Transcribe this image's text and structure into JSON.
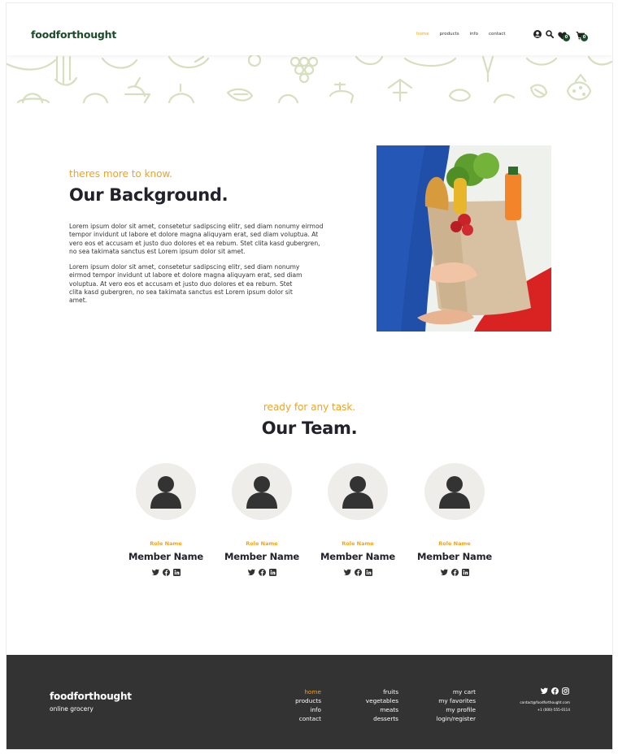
{
  "header": {
    "logo": "foodforthought",
    "nav": [
      "home",
      "products",
      "info",
      "contact"
    ],
    "favorites_count": "0",
    "cart_count": "0"
  },
  "background": {
    "subtitle": "theres more to know.",
    "title": "Our Background.",
    "paragraph1": "Lorem ipsum dolor sit amet, consetetur sadipscing elitr, sed diam nonumy eirmod tempor invidunt ut labore et dolore magna aliquyam erat, sed diam voluptua. At vero eos et accusam et justo duo dolores et ea rebum. Stet clita kasd gubergren, no sea takimata sanctus est Lorem ipsum dolor sit amet.",
    "paragraph2": "Lorem ipsum dolor sit amet, consetetur sadipscing elitr, sed diam nonumy eirmod tempor invidunt ut labore et dolore magna aliquyam erat, sed diam voluptua. At vero eos et accusam et justo duo dolores et ea rebum. Stet clita kasd gubergren, no sea takimata sanctus est Lorem ipsum dolor sit amet."
  },
  "team": {
    "subtitle": "ready for any task.",
    "title": "Our Team.",
    "members": [
      {
        "role": "Role Name",
        "name": "Member Name"
      },
      {
        "role": "Role Name",
        "name": "Member Name"
      },
      {
        "role": "Role Name",
        "name": "Member Name"
      },
      {
        "role": "Role Name",
        "name": "Member Name"
      }
    ]
  },
  "footer": {
    "logo": "foodforthought",
    "tagline": "online grocery",
    "nav_links": [
      "home",
      "products",
      "info",
      "contact"
    ],
    "category_links": [
      "fruits",
      "vegetables",
      "meats",
      "desserts"
    ],
    "account_links": [
      "my cart",
      "my favorites",
      "my profile",
      "login/register"
    ],
    "email": "contact@foodforthought.com",
    "phone": "+1 (000)-555-0114"
  },
  "colors": {
    "accent": "#f2a31b",
    "brand_green": "#1d4a2a",
    "footer_bg": "#333333",
    "pattern": "#dbe3c2"
  },
  "icons": [
    "user-icon",
    "search-icon",
    "heart-icon",
    "cart-icon",
    "twitter-icon",
    "facebook-icon",
    "linkedin-icon",
    "instagram-icon"
  ]
}
